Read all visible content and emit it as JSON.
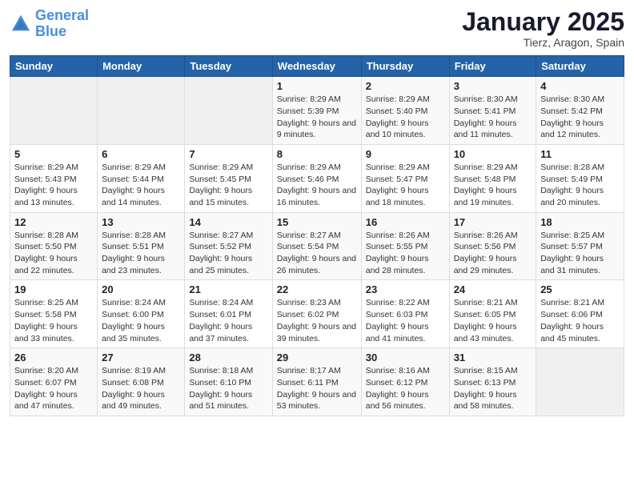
{
  "header": {
    "logo_line1": "General",
    "logo_line2": "Blue",
    "month_title": "January 2025",
    "subtitle": "Tierz, Aragon, Spain"
  },
  "days_of_week": [
    "Sunday",
    "Monday",
    "Tuesday",
    "Wednesday",
    "Thursday",
    "Friday",
    "Saturday"
  ],
  "weeks": [
    {
      "cells": [
        {
          "day": "",
          "content": ""
        },
        {
          "day": "",
          "content": ""
        },
        {
          "day": "",
          "content": ""
        },
        {
          "day": "1",
          "content": "Sunrise: 8:29 AM\nSunset: 5:39 PM\nDaylight: 9 hours and 9 minutes."
        },
        {
          "day": "2",
          "content": "Sunrise: 8:29 AM\nSunset: 5:40 PM\nDaylight: 9 hours and 10 minutes."
        },
        {
          "day": "3",
          "content": "Sunrise: 8:30 AM\nSunset: 5:41 PM\nDaylight: 9 hours and 11 minutes."
        },
        {
          "day": "4",
          "content": "Sunrise: 8:30 AM\nSunset: 5:42 PM\nDaylight: 9 hours and 12 minutes."
        }
      ]
    },
    {
      "cells": [
        {
          "day": "5",
          "content": "Sunrise: 8:29 AM\nSunset: 5:43 PM\nDaylight: 9 hours and 13 minutes."
        },
        {
          "day": "6",
          "content": "Sunrise: 8:29 AM\nSunset: 5:44 PM\nDaylight: 9 hours and 14 minutes."
        },
        {
          "day": "7",
          "content": "Sunrise: 8:29 AM\nSunset: 5:45 PM\nDaylight: 9 hours and 15 minutes."
        },
        {
          "day": "8",
          "content": "Sunrise: 8:29 AM\nSunset: 5:46 PM\nDaylight: 9 hours and 16 minutes."
        },
        {
          "day": "9",
          "content": "Sunrise: 8:29 AM\nSunset: 5:47 PM\nDaylight: 9 hours and 18 minutes."
        },
        {
          "day": "10",
          "content": "Sunrise: 8:29 AM\nSunset: 5:48 PM\nDaylight: 9 hours and 19 minutes."
        },
        {
          "day": "11",
          "content": "Sunrise: 8:28 AM\nSunset: 5:49 PM\nDaylight: 9 hours and 20 minutes."
        }
      ]
    },
    {
      "cells": [
        {
          "day": "12",
          "content": "Sunrise: 8:28 AM\nSunset: 5:50 PM\nDaylight: 9 hours and 22 minutes."
        },
        {
          "day": "13",
          "content": "Sunrise: 8:28 AM\nSunset: 5:51 PM\nDaylight: 9 hours and 23 minutes."
        },
        {
          "day": "14",
          "content": "Sunrise: 8:27 AM\nSunset: 5:52 PM\nDaylight: 9 hours and 25 minutes."
        },
        {
          "day": "15",
          "content": "Sunrise: 8:27 AM\nSunset: 5:54 PM\nDaylight: 9 hours and 26 minutes."
        },
        {
          "day": "16",
          "content": "Sunrise: 8:26 AM\nSunset: 5:55 PM\nDaylight: 9 hours and 28 minutes."
        },
        {
          "day": "17",
          "content": "Sunrise: 8:26 AM\nSunset: 5:56 PM\nDaylight: 9 hours and 29 minutes."
        },
        {
          "day": "18",
          "content": "Sunrise: 8:25 AM\nSunset: 5:57 PM\nDaylight: 9 hours and 31 minutes."
        }
      ]
    },
    {
      "cells": [
        {
          "day": "19",
          "content": "Sunrise: 8:25 AM\nSunset: 5:58 PM\nDaylight: 9 hours and 33 minutes."
        },
        {
          "day": "20",
          "content": "Sunrise: 8:24 AM\nSunset: 6:00 PM\nDaylight: 9 hours and 35 minutes."
        },
        {
          "day": "21",
          "content": "Sunrise: 8:24 AM\nSunset: 6:01 PM\nDaylight: 9 hours and 37 minutes."
        },
        {
          "day": "22",
          "content": "Sunrise: 8:23 AM\nSunset: 6:02 PM\nDaylight: 9 hours and 39 minutes."
        },
        {
          "day": "23",
          "content": "Sunrise: 8:22 AM\nSunset: 6:03 PM\nDaylight: 9 hours and 41 minutes."
        },
        {
          "day": "24",
          "content": "Sunrise: 8:21 AM\nSunset: 6:05 PM\nDaylight: 9 hours and 43 minutes."
        },
        {
          "day": "25",
          "content": "Sunrise: 8:21 AM\nSunset: 6:06 PM\nDaylight: 9 hours and 45 minutes."
        }
      ]
    },
    {
      "cells": [
        {
          "day": "26",
          "content": "Sunrise: 8:20 AM\nSunset: 6:07 PM\nDaylight: 9 hours and 47 minutes."
        },
        {
          "day": "27",
          "content": "Sunrise: 8:19 AM\nSunset: 6:08 PM\nDaylight: 9 hours and 49 minutes."
        },
        {
          "day": "28",
          "content": "Sunrise: 8:18 AM\nSunset: 6:10 PM\nDaylight: 9 hours and 51 minutes."
        },
        {
          "day": "29",
          "content": "Sunrise: 8:17 AM\nSunset: 6:11 PM\nDaylight: 9 hours and 53 minutes."
        },
        {
          "day": "30",
          "content": "Sunrise: 8:16 AM\nSunset: 6:12 PM\nDaylight: 9 hours and 56 minutes."
        },
        {
          "day": "31",
          "content": "Sunrise: 8:15 AM\nSunset: 6:13 PM\nDaylight: 9 hours and 58 minutes."
        },
        {
          "day": "",
          "content": ""
        }
      ]
    }
  ]
}
